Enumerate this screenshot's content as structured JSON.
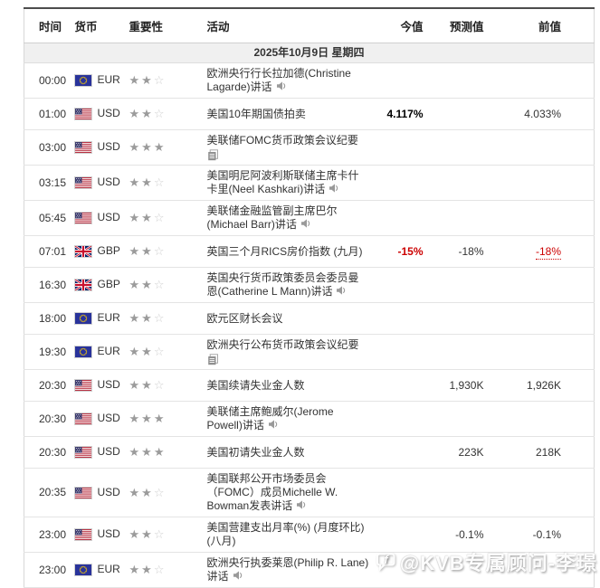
{
  "columns": [
    "时间",
    "货币",
    "重要性",
    "活动",
    "今值",
    "预测值",
    "前值"
  ],
  "date_header": "2025年10月9日 星期四",
  "colors": {
    "accent_red": "#cc0000",
    "actual_bold": "#000000",
    "date_row_bg": "#f0f0f0",
    "star_filled": "#9b9b9b",
    "star_empty": "#d0d0d0",
    "table_top_border": "#4d4d4d"
  },
  "watermark": {
    "logo_letter": "f",
    "text": "@KVB专属顾问-李璟"
  },
  "rows": [
    {
      "time": "00:00",
      "currency": "EUR",
      "importance": 2,
      "activity": "欧洲央行行长拉加德(Christine Lagarde)讲话",
      "icon": "speaker"
    },
    {
      "time": "01:00",
      "currency": "USD",
      "importance": 2,
      "activity": "美国10年期国债拍卖",
      "actual": {
        "text": "4.117%",
        "style": "bold"
      },
      "previous": {
        "text": "4.033%"
      }
    },
    {
      "time": "03:00",
      "currency": "USD",
      "importance": 3,
      "activity": "美联储FOMC货币政策会议纪要",
      "icon": "doc"
    },
    {
      "time": "03:15",
      "currency": "USD",
      "importance": 2,
      "activity": "美国明尼阿波利斯联储主席卡什卡里(Neel Kashkari)讲话",
      "icon": "speaker"
    },
    {
      "time": "05:45",
      "currency": "USD",
      "importance": 2,
      "activity": "美联储金融监管副主席巴尔(Michael Barr)讲话",
      "icon": "speaker"
    },
    {
      "time": "07:01",
      "currency": "GBP",
      "importance": 2,
      "activity": "英国三个月RICS房价指数 (九月)",
      "actual": {
        "text": "-15%",
        "style": "bold red"
      },
      "forecast": {
        "text": "-18%"
      },
      "previous": {
        "text": "-18%",
        "style": "red revised"
      }
    },
    {
      "time": "16:30",
      "currency": "GBP",
      "importance": 2,
      "activity": "英国央行货币政策委员会委员曼恩(Catherine L Mann)讲话",
      "icon": "speaker"
    },
    {
      "time": "18:00",
      "currency": "EUR",
      "importance": 2,
      "activity": "欧元区财长会议"
    },
    {
      "time": "19:30",
      "currency": "EUR",
      "importance": 2,
      "activity": "欧洲央行公布货币政策会议纪要",
      "icon": "doc"
    },
    {
      "time": "20:30",
      "currency": "USD",
      "importance": 2,
      "activity": "美国续请失业金人数",
      "forecast": {
        "text": "1,930K"
      },
      "previous": {
        "text": "1,926K"
      }
    },
    {
      "time": "20:30",
      "currency": "USD",
      "importance": 3,
      "activity": "美联储主席鲍威尔(Jerome Powell)讲话",
      "icon": "speaker"
    },
    {
      "time": "20:30",
      "currency": "USD",
      "importance": 3,
      "activity": "美国初请失业金人数",
      "forecast": {
        "text": "223K"
      },
      "previous": {
        "text": "218K"
      }
    },
    {
      "time": "20:35",
      "currency": "USD",
      "importance": 2,
      "activity": "美国联邦公开市场委员会（FOMC）成员Michelle W. Bowman发表讲话",
      "icon": "speaker"
    },
    {
      "time": "23:00",
      "currency": "USD",
      "importance": 2,
      "activity": "美国营建支出月率(%) (月度环比) (八月)",
      "forecast": {
        "text": "-0.1%"
      },
      "previous": {
        "text": "-0.1%"
      }
    },
    {
      "time": "23:00",
      "currency": "EUR",
      "importance": 2,
      "activity": "欧洲央行执委莱恩(Philip R. Lane)讲话",
      "icon": "speaker"
    }
  ]
}
